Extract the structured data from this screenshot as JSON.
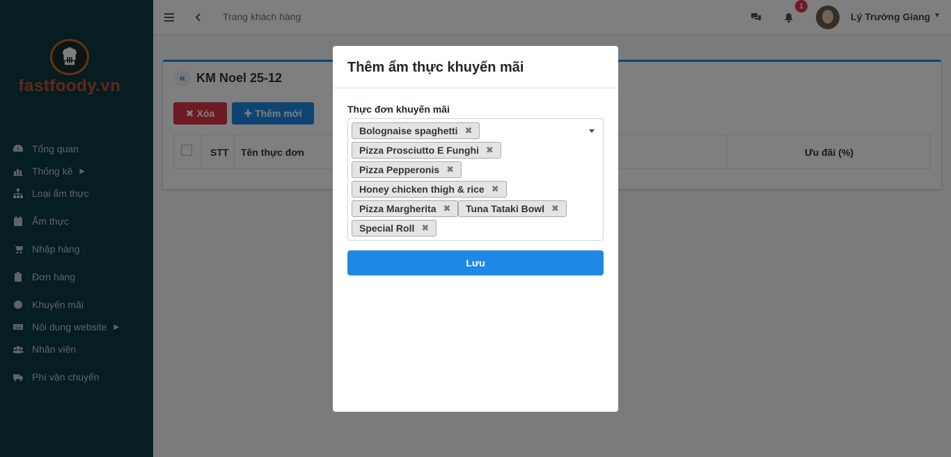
{
  "brand": {
    "name": "fastfoody.vn",
    "logo_icon": "chef-hat-icon"
  },
  "sidebar": {
    "items": [
      {
        "label": "Tổng quan",
        "icon": "dashboard-icon"
      },
      {
        "label": "Thống kê",
        "icon": "chart-icon",
        "has_submenu": true
      },
      {
        "label": "Loại ẩm thực",
        "icon": "sitemap-icon"
      },
      {
        "label": "Ẩm thực",
        "icon": "calendar-icon"
      },
      {
        "label": "Nhập hàng",
        "icon": "cart-icon"
      },
      {
        "label": "Đơn hàng",
        "icon": "clipboard-icon"
      },
      {
        "label": "Khuyến mãi",
        "icon": "circle-icon"
      },
      {
        "label": "Nội dung website",
        "icon": "keyboard-icon",
        "has_submenu": true
      },
      {
        "label": "Nhân viên",
        "icon": "users-icon"
      },
      {
        "label": "Phí vận chuyển",
        "icon": "truck-icon"
      }
    ]
  },
  "topbar": {
    "menu_icon": "hamburger-icon",
    "back_icon": "chevron-left-icon",
    "link": "Trang khách hàng",
    "chat_icon": "comments-icon",
    "bell_icon": "bell-icon",
    "notification_count": "1",
    "user_name": "Lý Trường Giang"
  },
  "card": {
    "title": "KM Noel 25-12",
    "back_symbol": "«",
    "delete_label": "Xóa",
    "add_label": "Thêm mới",
    "columns": {
      "stt": "STT",
      "name": "Tên thực đơn",
      "discount": "Ưu đãi (%)"
    }
  },
  "modal": {
    "title": "Thêm ẩm thực khuyến mãi",
    "field_label": "Thực đơn khuyến mãi",
    "selected_items": [
      "Bolognaise spaghetti",
      "Pizza Prosciutto E Funghi",
      "Pizza Pepperonis",
      "Honey chicken thigh & rice",
      "Pizza Margherita",
      "Tuna Tataki Bowl",
      "Special Roll"
    ],
    "remove_symbol": "✖",
    "save_label": "Lưu"
  },
  "colors": {
    "accent": "#1e88e5",
    "danger": "#dc3545",
    "sidebar": "#0c3a44",
    "brand": "#c5512a"
  }
}
